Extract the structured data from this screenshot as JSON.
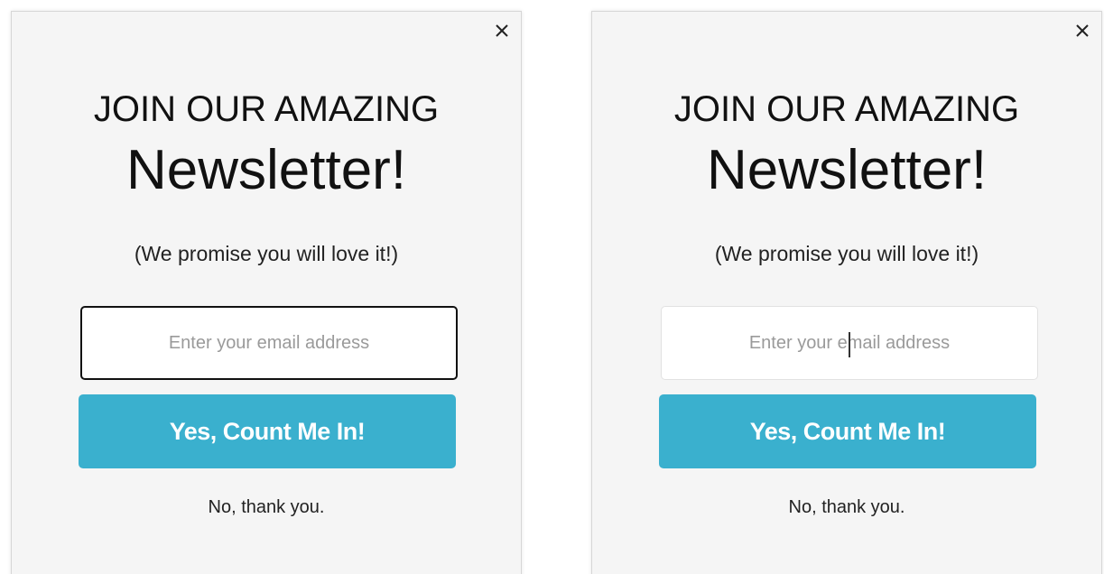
{
  "popups": [
    {
      "state": "focused",
      "close_icon": "close-icon",
      "heading_small": "JOIN OUR AMAZING",
      "heading_big": "Newsletter!",
      "tagline": "(We promise you will love it!)",
      "email_placeholder": "Enter your email address",
      "email_value": "",
      "cta_label": "Yes, Count Me In!",
      "decline_label": "No, thank you."
    },
    {
      "state": "unfocused",
      "close_icon": "close-icon",
      "heading_small": "JOIN OUR AMAZING",
      "heading_big": "Newsletter!",
      "tagline": "(We promise you will love it!)",
      "email_placeholder": "Enter your email address",
      "email_value": "",
      "cta_label": "Yes, Count Me In!",
      "decline_label": "No, thank you."
    }
  ],
  "colors": {
    "modal_background": "#f5f5f5",
    "cta_background": "#3ab0ce",
    "cta_text": "#ffffff",
    "text_primary": "#111111",
    "placeholder": "#9a9a9a",
    "focus_border": "#111111"
  }
}
